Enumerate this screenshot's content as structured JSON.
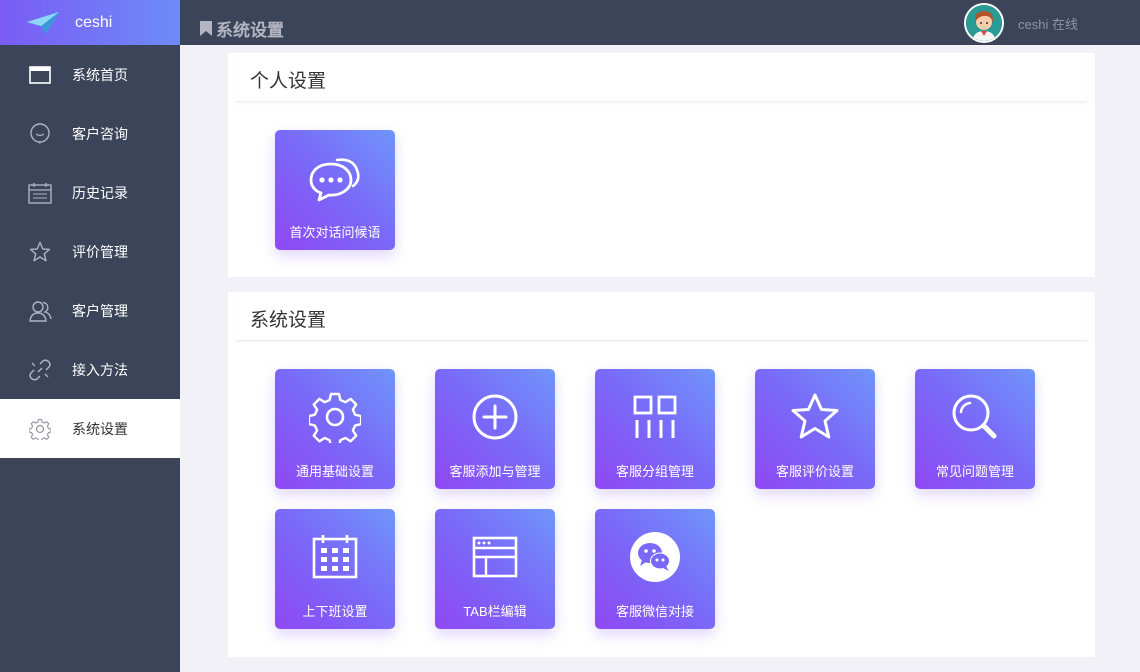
{
  "brand": {
    "name": "ceshi"
  },
  "sidebar": {
    "items": [
      {
        "label": "系统首页",
        "icon": "window-icon"
      },
      {
        "label": "客户咨询",
        "icon": "chat-bubble-icon"
      },
      {
        "label": "历史记录",
        "icon": "calendar-list-icon"
      },
      {
        "label": "评价管理",
        "icon": "star-icon"
      },
      {
        "label": "客户管理",
        "icon": "users-icon"
      },
      {
        "label": "接入方法",
        "icon": "link-icon"
      },
      {
        "label": "系统设置",
        "icon": "gear-icon",
        "active": true
      }
    ]
  },
  "header": {
    "breadcrumb": "系统设置",
    "user_status": "ceshi 在线"
  },
  "personal": {
    "title": "个人设置",
    "tiles": [
      {
        "label": "首次对话问候语",
        "icon": "chat-dots-icon"
      }
    ]
  },
  "system": {
    "title": "系统设置",
    "tiles": [
      {
        "label": "通用基础设置",
        "icon": "gear-icon"
      },
      {
        "label": "客服添加与管理",
        "icon": "plus-circle-icon"
      },
      {
        "label": "客服分组管理",
        "icon": "group-grid-icon"
      },
      {
        "label": "客服评价设置",
        "icon": "star-icon"
      },
      {
        "label": "常见问题管理",
        "icon": "search-icon"
      },
      {
        "label": "上下班设置",
        "icon": "calendar-icon"
      },
      {
        "label": "TAB栏编辑",
        "icon": "browser-window-icon"
      },
      {
        "label": "客服微信对接",
        "icon": "wechat-icon"
      }
    ]
  },
  "colors": {
    "sidebar": "#3c4459",
    "accent_start": "#7a5cf5",
    "accent_end": "#6f95fb",
    "page_bg": "#f2f1f8"
  }
}
